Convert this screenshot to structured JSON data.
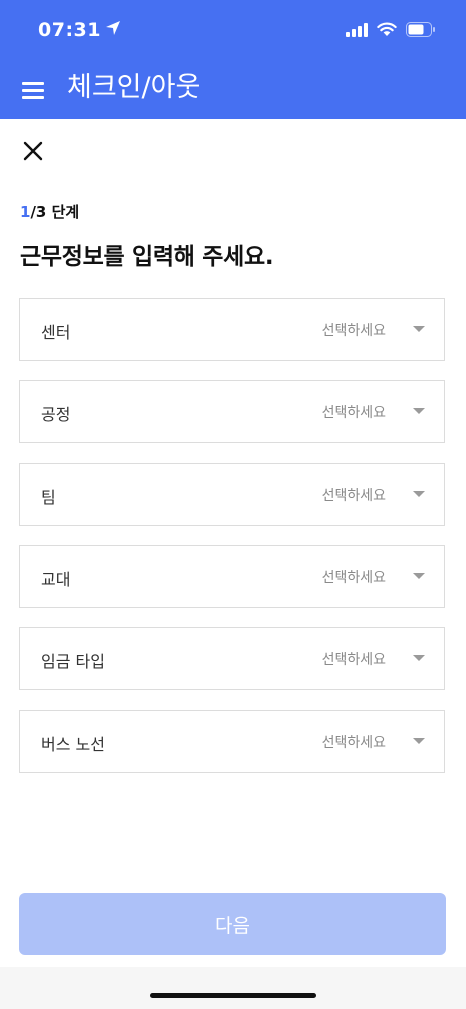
{
  "status_bar": {
    "time": "07:31"
  },
  "app_bar": {
    "title": "체크인/아웃"
  },
  "step": {
    "current": "1",
    "rest": "/3 단계"
  },
  "heading": "근무정보를 입력해 주세요.",
  "fields": [
    {
      "label": "센터",
      "value": "선택하세요"
    },
    {
      "label": "공정",
      "value": "선택하세요"
    },
    {
      "label": "팀",
      "value": "선택하세요"
    },
    {
      "label": "교대",
      "value": "선택하세요"
    },
    {
      "label": "임금 타입",
      "value": "선택하세요"
    },
    {
      "label": "버스 노선",
      "value": "선택하세요"
    }
  ],
  "next_button": {
    "label": "다음"
  },
  "colors": {
    "brand": "#4670F2",
    "button_disabled": "#ADC1F8"
  }
}
